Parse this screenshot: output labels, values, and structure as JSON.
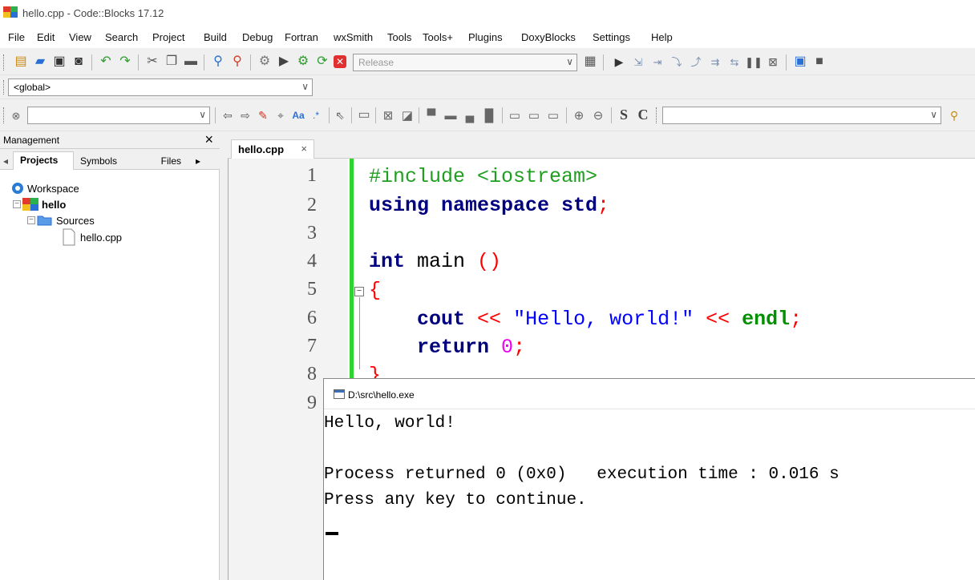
{
  "window": {
    "title": "hello.cpp - Code::Blocks 17.12"
  },
  "menu": [
    "File",
    "Edit",
    "View",
    "Search",
    "Project",
    "Build",
    "Debug",
    "Fortran",
    "wxSmith",
    "Tools",
    "Tools+",
    "Plugins",
    "DoxyBlocks",
    "Settings",
    "Help"
  ],
  "toolbar": {
    "build_target": "Release",
    "scope": "<global>",
    "search_value": "",
    "icons": [
      "new-file-icon",
      "open-icon",
      "save-icon",
      "save-all-icon",
      "undo-icon",
      "redo-icon",
      "cut-icon",
      "copy-icon",
      "paste-icon",
      "find-icon",
      "replace-icon",
      "build-icon",
      "run-icon",
      "build-run-icon",
      "rebuild-icon",
      "abort-icon"
    ],
    "format_letters": [
      "S",
      "C"
    ],
    "regex_label": ".*",
    "match_case_label": "Aa"
  },
  "management": {
    "title": "Management",
    "tabs": [
      "Projects",
      "Symbols",
      "Files"
    ],
    "tree": [
      {
        "label": "Workspace",
        "icon": "workspace-icon"
      },
      {
        "label": "hello",
        "icon": "project-icon"
      },
      {
        "label": "Sources",
        "icon": "folder-open-icon"
      },
      {
        "label": "hello.cpp",
        "icon": "file-icon"
      }
    ]
  },
  "editor": {
    "tab": "hello.cpp",
    "line_numbers": [
      "1",
      "2",
      "3",
      "4",
      "5",
      "6",
      "7",
      "8",
      "9"
    ]
  },
  "console": {
    "title": "D:\\src\\hello.exe",
    "lines": [
      "Hello, world!",
      "",
      "Process returned 0 (0x0)   execution time : 0.016 s",
      "Press any key to continue."
    ]
  },
  "colors": {
    "keyword": "#00007f",
    "preprocessor": "#1f9e1f",
    "string": "#0000ff",
    "operator": "#ff0000",
    "number": "#f000f0",
    "change_bar": "#2fd42f"
  }
}
